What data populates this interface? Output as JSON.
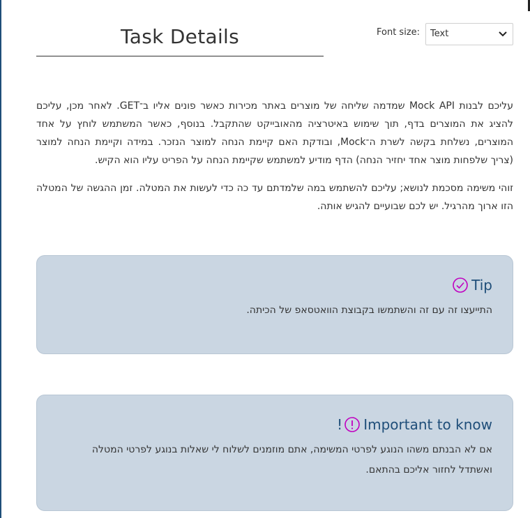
{
  "header": {
    "title": "Task Details",
    "font_size_label": "Font size:",
    "font_size_selected": "Text"
  },
  "content": {
    "paragraphs": [
      "עליכם לבנות Mock API שמדמה שליחה של מוצרים באתר מכירות כאשר פונים אליו ב־GET. לאחר מכן, עליכם להציג את המוצרים בדף, תוך שימוש באיטרציה מהאובייקט שהתקבל. בנוסף, כאשר המשתמש לוחץ על אחד המוצרים, נשלחת בקשה לשרת ה־Mock, ובודקת האם קיימת הנחה למוצר הנזכר. במידה וקיימת הנחה למוצר (צריך שלפחות מוצר אחד יחזיר הנחה) הדף מודיע למשתמש שקיימת הנחה על הפריט עליו הוא הקיש.",
      "זוהי משימה מסכמת לנושא; עליכם להשתמש במה שלמדתם עד כה כדי לעשות את המטלה. זמן ההגשה של המטלה הזו ארוך מהרגיל. יש לכם שבועיים להגיש אותה."
    ]
  },
  "tip": {
    "heading": "Tip",
    "icon": "check-circle-icon",
    "body": "התייעצו זה עם זה והשתמשו בקבוצת הוואטסאפ של הכיתה."
  },
  "important": {
    "heading": "Important to know",
    "icon": "exclamation-circle-icon",
    "suffix": "!",
    "body": "אם לא הבנתם משהו הנוגע לפרטי המשימה, אתם מוזמנים לשלוח לי שאלות בנוגע לפרטי המטלה ואשתדל לחזור אליכם בהתאם."
  },
  "colors": {
    "card_background": "#cad6e2",
    "heading_blue": "#1f4e79",
    "icon_magenta": "#c000c0"
  }
}
